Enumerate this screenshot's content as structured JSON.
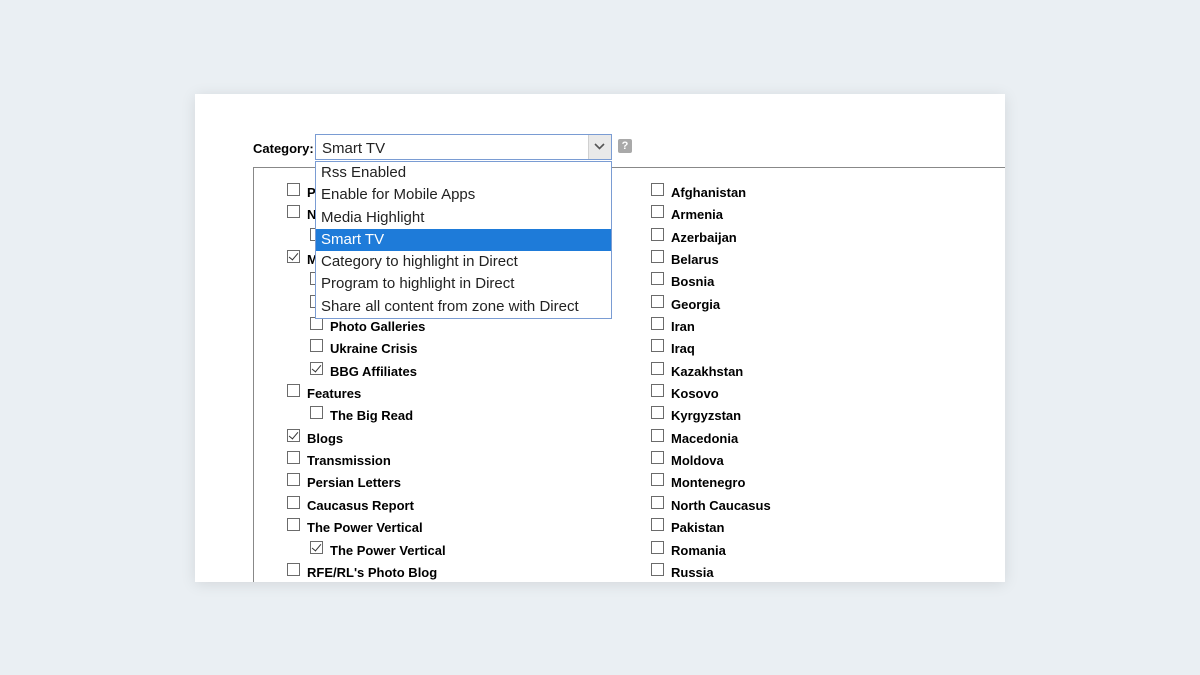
{
  "category": {
    "label": "Category:",
    "selected": "Smart TV",
    "help_glyph": "?",
    "options": [
      {
        "label": "Rss Enabled",
        "selected": false
      },
      {
        "label": "Enable for Mobile Apps",
        "selected": false
      },
      {
        "label": "Media Highlight",
        "selected": false
      },
      {
        "label": "Smart TV",
        "selected": true
      },
      {
        "label": "Category to highlight in Direct",
        "selected": false
      },
      {
        "label": "Program to highlight in Direct",
        "selected": false
      },
      {
        "label": "Share all content from zone with Direct",
        "selected": false
      }
    ]
  },
  "left_tree": [
    {
      "label": "P",
      "checked": false,
      "level": 0
    },
    {
      "label": "N",
      "checked": false,
      "level": 0
    },
    {
      "label": "",
      "checked": false,
      "level": 1
    },
    {
      "label": "M",
      "checked": true,
      "level": 0
    },
    {
      "label": "",
      "checked": false,
      "level": 1
    },
    {
      "label": "",
      "checked": false,
      "level": 1
    },
    {
      "label": "Photo Galleries",
      "checked": false,
      "level": 1
    },
    {
      "label": "Ukraine Crisis",
      "checked": false,
      "level": 1
    },
    {
      "label": "BBG Affiliates",
      "checked": true,
      "level": 1
    },
    {
      "label": "Features",
      "checked": false,
      "level": 0
    },
    {
      "label": "The Big Read",
      "checked": false,
      "level": 1
    },
    {
      "label": "Blogs",
      "checked": true,
      "level": 0
    },
    {
      "label": "Transmission",
      "checked": false,
      "level": 0
    },
    {
      "label": "Persian Letters",
      "checked": false,
      "level": 0
    },
    {
      "label": "Caucasus Report",
      "checked": false,
      "level": 0
    },
    {
      "label": "The Power Vertical",
      "checked": false,
      "level": 0
    },
    {
      "label": "The Power Vertical",
      "checked": true,
      "level": 1
    },
    {
      "label": "RFE/RL's Photo Blog",
      "checked": false,
      "level": 0
    }
  ],
  "right_tree": [
    {
      "label": "Afghanistan",
      "checked": false
    },
    {
      "label": "Armenia",
      "checked": false
    },
    {
      "label": "Azerbaijan",
      "checked": false
    },
    {
      "label": "Belarus",
      "checked": false
    },
    {
      "label": "Bosnia",
      "checked": false
    },
    {
      "label": "Georgia",
      "checked": false
    },
    {
      "label": "Iran",
      "checked": false
    },
    {
      "label": "Iraq",
      "checked": false
    },
    {
      "label": "Kazakhstan",
      "checked": false
    },
    {
      "label": "Kosovo",
      "checked": false
    },
    {
      "label": "Kyrgyzstan",
      "checked": false
    },
    {
      "label": "Macedonia",
      "checked": false
    },
    {
      "label": "Moldova",
      "checked": false
    },
    {
      "label": "Montenegro",
      "checked": false
    },
    {
      "label": "North Caucasus",
      "checked": false
    },
    {
      "label": "Pakistan",
      "checked": false
    },
    {
      "label": "Romania",
      "checked": false
    },
    {
      "label": "Russia",
      "checked": false
    }
  ]
}
